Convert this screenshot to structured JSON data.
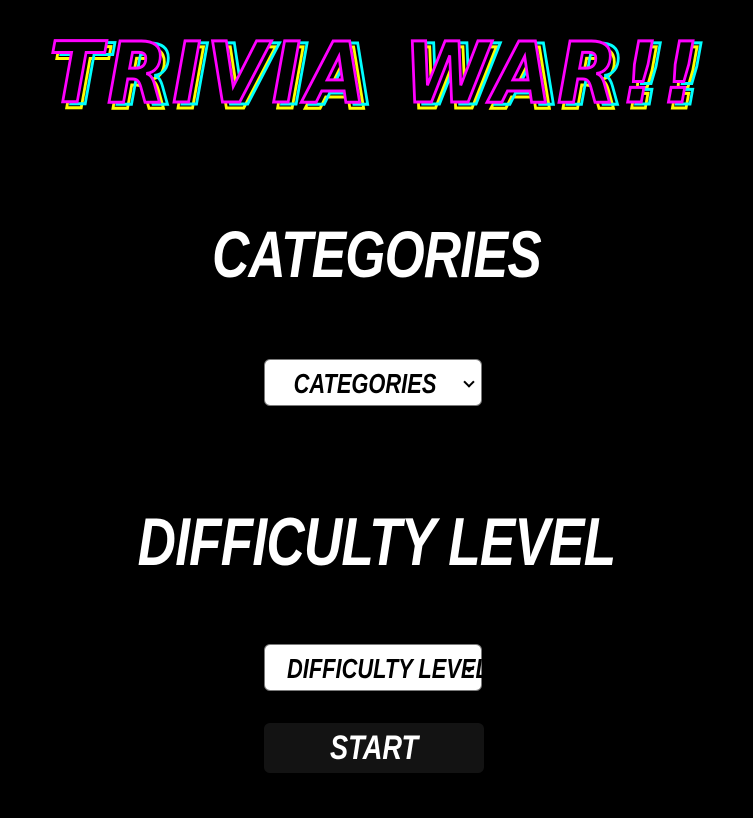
{
  "header": {
    "title": "TRIVIA WAR!!"
  },
  "categories": {
    "heading": "CATEGORIES",
    "select_value": "CATEGORIES"
  },
  "difficulty": {
    "heading": "DIFFICULTY LEVEL",
    "select_value": "DIFFICULTY LEVEL"
  },
  "actions": {
    "start_label": "START"
  },
  "colors": {
    "background": "#000000",
    "title_magenta": "#ff00ff",
    "title_cyan": "#00ffff",
    "title_yellow": "#ffff00",
    "text": "#ffffff",
    "button_bg": "#131313"
  },
  "icons": {
    "select_arrow": "chevron-down-icon"
  }
}
